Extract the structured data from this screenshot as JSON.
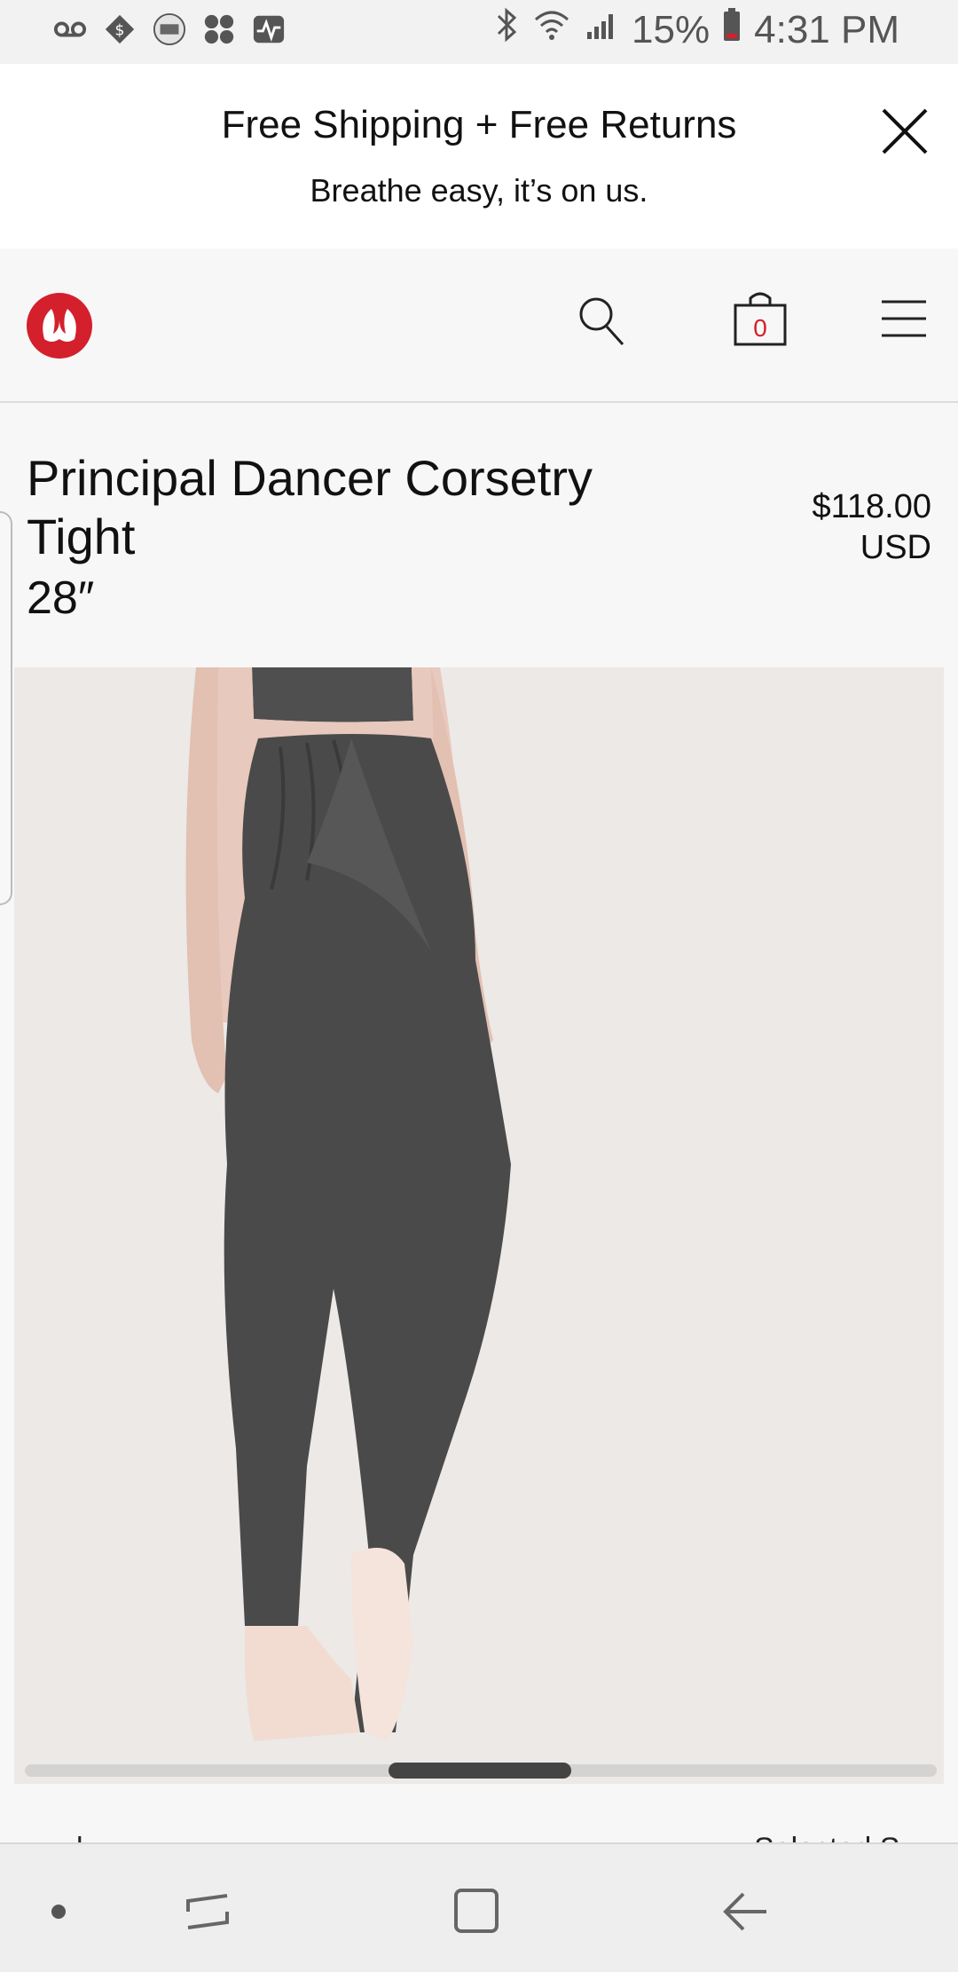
{
  "status_bar": {
    "icons_left": [
      "voicemail-icon",
      "dollar-tag-icon",
      "toon-blast-icon",
      "game-icon",
      "activity-icon"
    ],
    "icons_right": [
      "bluetooth-icon",
      "wifi-icon",
      "signal-icon",
      "battery-icon"
    ],
    "battery": "15%",
    "time": "4:31 PM"
  },
  "promo": {
    "title": "Free Shipping + Free Returns",
    "subtitle": "Breathe easy, it’s on us."
  },
  "header": {
    "bag_count": "0"
  },
  "product": {
    "name": "Principal Dancer Corsetry Tight",
    "length": "28″",
    "price": "$118.00",
    "currency": "USD"
  },
  "below": {
    "left_fragment": "l",
    "right_fragment": "Selected S"
  },
  "colors": {
    "brand_red": "#d3202c",
    "tights_gray": "#4a4a4a",
    "background": "#f7f7f7"
  }
}
